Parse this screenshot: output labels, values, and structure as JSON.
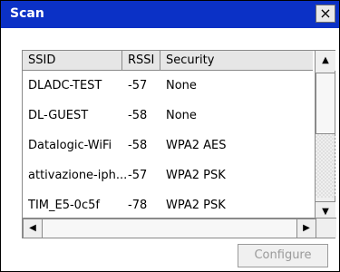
{
  "window": {
    "title": "Scan",
    "close_label": "×"
  },
  "table": {
    "columns": [
      "SSID",
      "RSSI",
      "Security"
    ],
    "rows": [
      {
        "ssid": "DLADC-TEST",
        "rssi": "-57",
        "security": "None"
      },
      {
        "ssid": "DL-GUEST",
        "rssi": "-58",
        "security": "None"
      },
      {
        "ssid": "Datalogic-WiFi",
        "rssi": "-58",
        "security": "WPA2 AES"
      },
      {
        "ssid": "attivazione-iph...",
        "rssi": "-57",
        "security": "WPA2 PSK"
      },
      {
        "ssid": "TIM_E5-0c5f",
        "rssi": "-78",
        "security": "WPA2 PSK"
      }
    ]
  },
  "scroll": {
    "up_glyph": "▲",
    "down_glyph": "▼",
    "left_glyph": "◀",
    "right_glyph": "▶"
  },
  "actions": {
    "configure_label": "Configure"
  }
}
